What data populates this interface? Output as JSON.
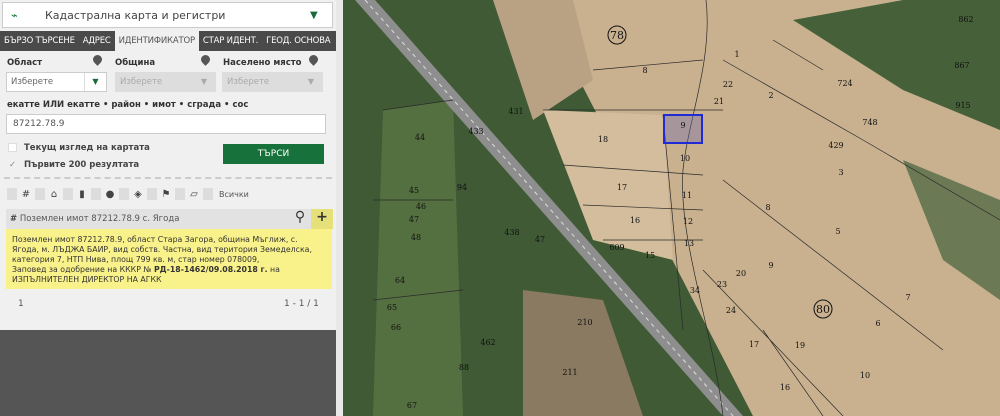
{
  "header": {
    "title": "Кадастрална карта и регистри",
    "logo": "cadastre-logo"
  },
  "tabs": [
    "БЪРЗО ТЪРСЕНЕ",
    "АДРЕС",
    "ИДЕНТИФИКАТОР",
    "СТАР ИДЕНТ.",
    "ГЕОД. ОСНОВА"
  ],
  "filters": {
    "region_label": "Област",
    "municipality_label": "Община",
    "settlement_label": "Населено място",
    "region_value": "Изберете",
    "municipality_value": "Изберете",
    "settlement_value": "Изберете"
  },
  "search": {
    "label": "екатте ИЛИ екатте • район • имот • сграда • сос",
    "value": "87212.78.9",
    "current_view": "Текущ изглед на картата",
    "first200": "Първите 200 резултата",
    "button": "ТЪРСИ"
  },
  "toolbar": {
    "all_label": "Всички"
  },
  "result": {
    "title": "Поземлен имот 87212.78.9 с. Ягода",
    "text1": "Поземлен имот 87212.78.9, област Стара Загора, община Мъглиж, с. Ягода, м. ЛЪДЖА БАИР, вид собств. Частна, вид територия Земеделска, категория 7, НТП Нива, площ 799 кв. м, стар номер 078009,",
    "text2": "Заповед за одобрение на КККР № ",
    "order": "РД-18-1462/09.08.2018 г.",
    "text3": " на ИЗПЪЛНИТЕЛЕН ДИРЕКТОР НА АГКК"
  },
  "pager": {
    "page": "1",
    "range": "1 - 1 / 1"
  },
  "map": {
    "selected_parcel": "9",
    "selected_color": "#1f2bd6",
    "circled": [
      "78",
      "80"
    ],
    "labels": [
      "8",
      "1",
      "22",
      "21",
      "2",
      "9",
      "10",
      "18",
      "17",
      "11",
      "16",
      "12",
      "13",
      "15",
      "609",
      "3",
      "8",
      "5",
      "9",
      "20",
      "23",
      "24",
      "6",
      "7",
      "17",
      "19",
      "10",
      "16",
      "44",
      "45",
      "46",
      "47",
      "48",
      "64",
      "65",
      "66",
      "88",
      "67",
      "211",
      "210",
      "462",
      "438",
      "47",
      "433",
      "431",
      "94",
      "34",
      "429",
      "748",
      "724",
      "862",
      "867",
      "915"
    ]
  }
}
